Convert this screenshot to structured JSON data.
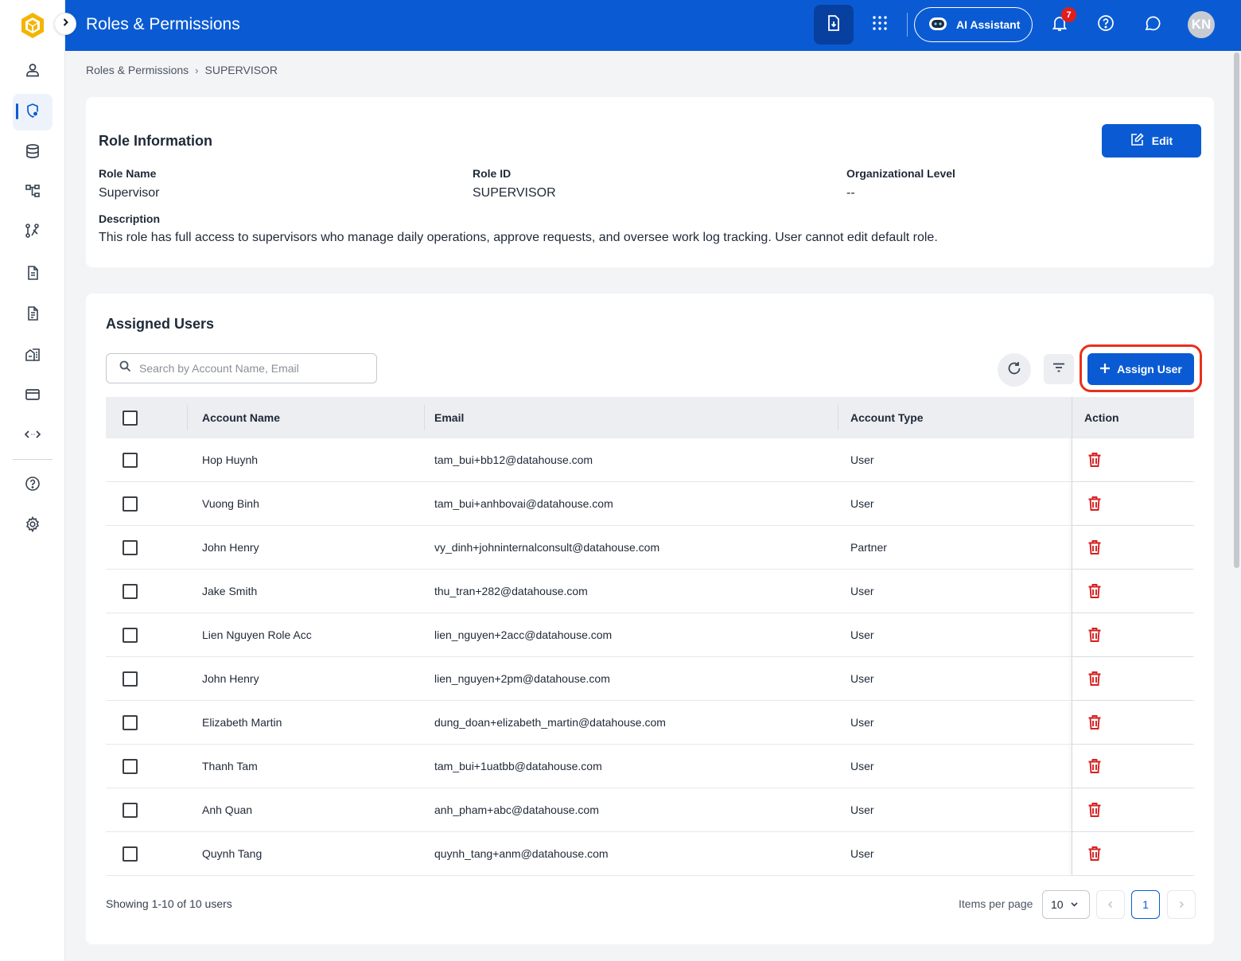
{
  "app": {
    "title": "Roles & Permissions"
  },
  "topbar": {
    "ai_label": "AI Assistant",
    "notification_count": "7",
    "avatar_initials": "KN",
    "accent": "#0a5bd3"
  },
  "sidebar": {
    "items": [
      {
        "icon": "user-icon",
        "active": false
      },
      {
        "icon": "shield-lock-icon",
        "active": true
      },
      {
        "icon": "database-icon",
        "active": false
      },
      {
        "icon": "hierarchy-icon",
        "active": false
      },
      {
        "icon": "workflow-icon",
        "active": false
      },
      {
        "icon": "document-icon",
        "active": false
      },
      {
        "icon": "document-list-icon",
        "active": false
      },
      {
        "icon": "building-icon",
        "active": false
      },
      {
        "icon": "card-icon",
        "active": false
      },
      {
        "icon": "code-arrows-icon",
        "active": false
      },
      {
        "icon": "help-icon",
        "active": false
      },
      {
        "icon": "settings-icon",
        "active": false
      }
    ]
  },
  "breadcrumb": {
    "parent": "Roles & Permissions",
    "separator": "›",
    "current": "SUPERVISOR"
  },
  "role_info": {
    "title": "Role Information",
    "edit_label": "Edit",
    "role_name_label": "Role Name",
    "role_name": "Supervisor",
    "role_id_label": "Role ID",
    "role_id": "SUPERVISOR",
    "org_level_label": "Organizational Level",
    "org_level": "--",
    "description_label": "Description",
    "description": "This role has full access to supervisors who manage daily operations, approve requests, and oversee work log tracking. User cannot edit default role."
  },
  "assigned_users": {
    "title": "Assigned Users",
    "search_placeholder": "Search by Account Name, Email",
    "assign_label": "Assign User",
    "columns": {
      "name": "Account Name",
      "email": "Email",
      "type": "Account Type",
      "action": "Action"
    },
    "rows": [
      {
        "name": "Hop Huynh",
        "email": "tam_bui+bb12@datahouse.com",
        "type": "User"
      },
      {
        "name": "Vuong Binh",
        "email": "tam_bui+anhbovai@datahouse.com",
        "type": "User"
      },
      {
        "name": "John Henry",
        "email": "vy_dinh+johninternalconsult@datahouse.com",
        "type": "Partner"
      },
      {
        "name": "Jake Smith",
        "email": "thu_tran+282@datahouse.com",
        "type": "User"
      },
      {
        "name": "Lien Nguyen Role Acc",
        "email": "lien_nguyen+2acc@datahouse.com",
        "type": "User"
      },
      {
        "name": "John Henry",
        "email": "lien_nguyen+2pm@datahouse.com",
        "type": "User"
      },
      {
        "name": "Elizabeth Martin",
        "email": "dung_doan+elizabeth_martin@datahouse.com",
        "type": "User"
      },
      {
        "name": "Thanh Tam",
        "email": "tam_bui+1uatbb@datahouse.com",
        "type": "User"
      },
      {
        "name": "Anh Quan",
        "email": "anh_pham+abc@datahouse.com",
        "type": "User"
      },
      {
        "name": "Quynh Tang",
        "email": "quynh_tang+anm@datahouse.com",
        "type": "User"
      }
    ],
    "showing": "Showing 1-10 of 10 users",
    "items_per_page_label": "Items per page",
    "items_per_page": "10",
    "current_page": "1"
  }
}
